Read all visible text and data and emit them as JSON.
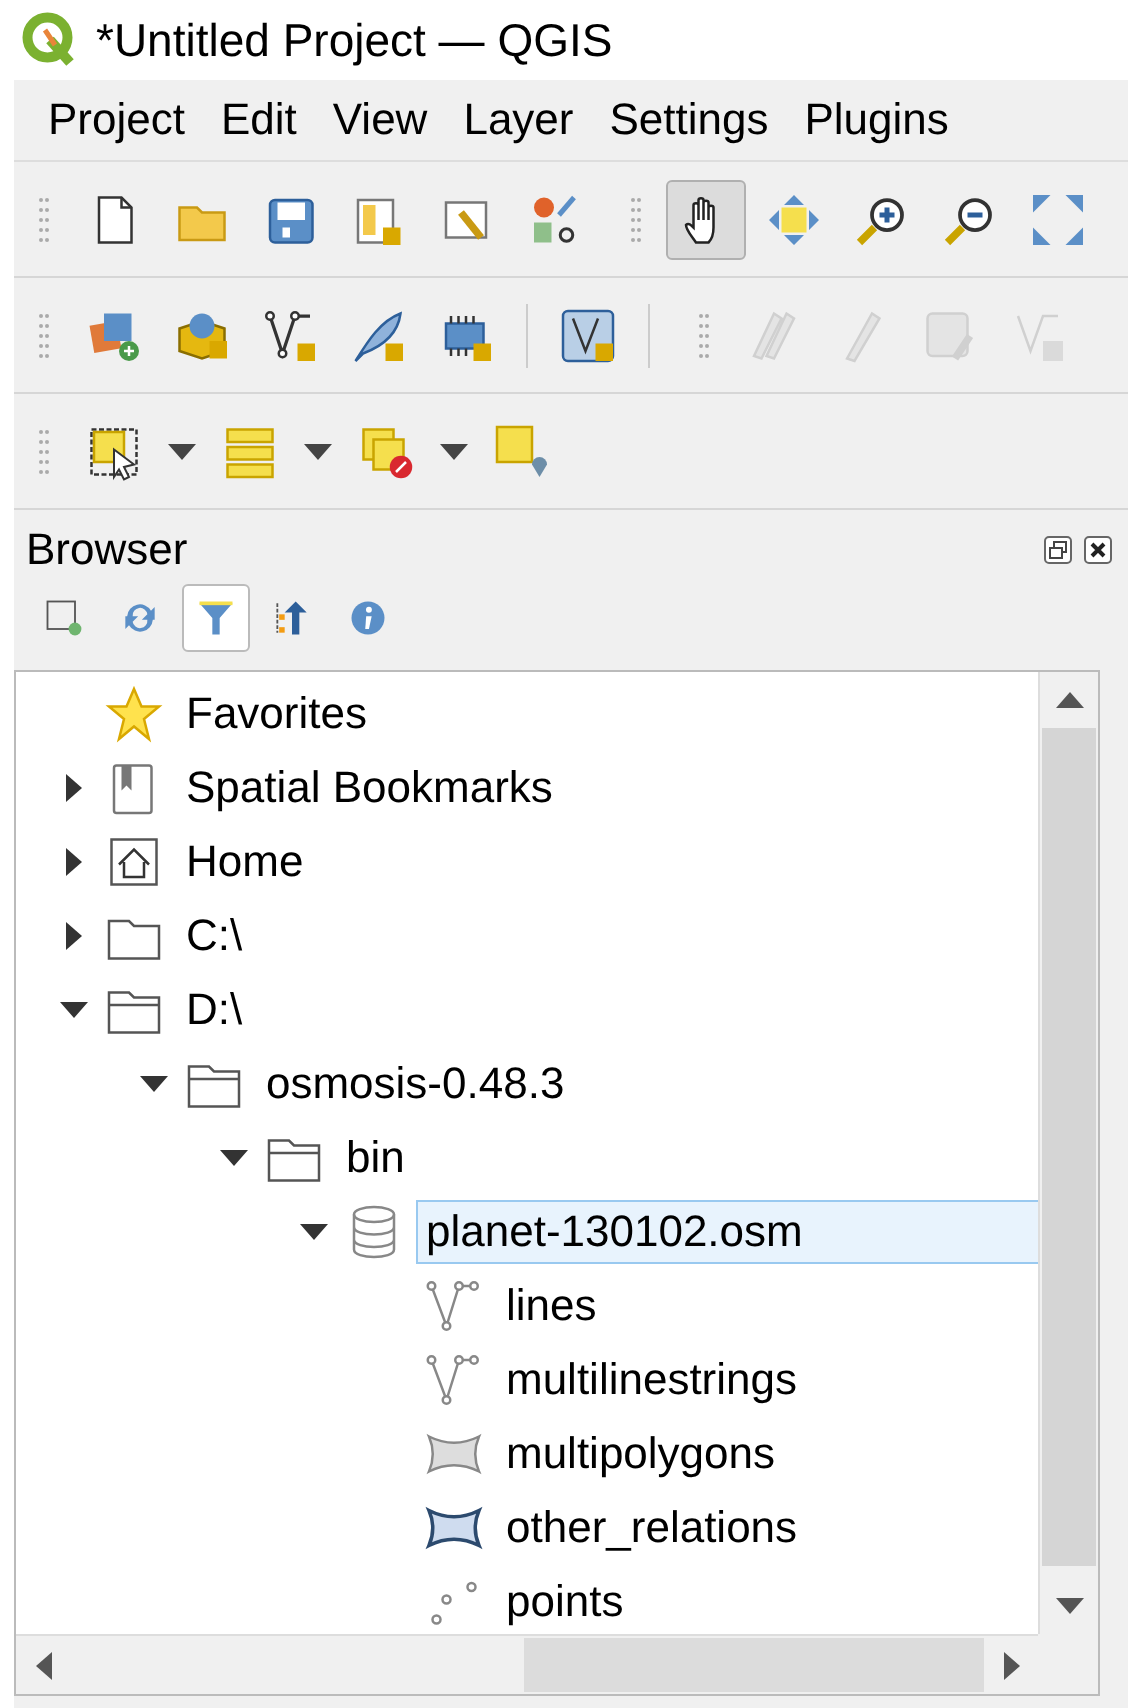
{
  "window": {
    "title": "*Untitled Project — QGIS"
  },
  "menu": [
    {
      "label": "Project"
    },
    {
      "label": "Edit"
    },
    {
      "label": "View"
    },
    {
      "label": "Layer"
    },
    {
      "label": "Settings"
    },
    {
      "label": "Plugins"
    }
  ],
  "toolbars": [
    {
      "buttons": [
        {
          "kind": "new",
          "pressed": false,
          "disabled": false
        },
        {
          "kind": "open",
          "pressed": false,
          "disabled": false
        },
        {
          "kind": "save",
          "pressed": false,
          "disabled": false
        },
        {
          "kind": "layout",
          "pressed": false,
          "disabled": false
        },
        {
          "kind": "manager",
          "pressed": false,
          "disabled": false
        },
        {
          "kind": "style",
          "pressed": false,
          "disabled": false
        },
        {
          "kind": "separator"
        },
        {
          "kind": "pan",
          "pressed": true,
          "disabled": false
        },
        {
          "kind": "pan-selection",
          "pressed": false,
          "disabled": false
        },
        {
          "kind": "zoom-in",
          "pressed": false,
          "disabled": false
        },
        {
          "kind": "zoom-out",
          "pressed": false,
          "disabled": false
        },
        {
          "kind": "zoom-full",
          "pressed": false,
          "disabled": false
        }
      ]
    },
    {
      "buttons": [
        {
          "kind": "add-layers",
          "pressed": false,
          "disabled": false
        },
        {
          "kind": "globe-box",
          "pressed": false,
          "disabled": false
        },
        {
          "kind": "vertex-line",
          "pressed": false,
          "disabled": false
        },
        {
          "kind": "feather",
          "pressed": false,
          "disabled": false
        },
        {
          "kind": "chip",
          "pressed": false,
          "disabled": false
        },
        {
          "kind": "divider"
        },
        {
          "kind": "vertex-frame",
          "pressed": false,
          "disabled": false
        },
        {
          "kind": "divider"
        },
        {
          "kind": "separator"
        },
        {
          "kind": "pencils",
          "pressed": false,
          "disabled": true
        },
        {
          "kind": "pencil",
          "pressed": false,
          "disabled": true
        },
        {
          "kind": "save-edit",
          "pressed": false,
          "disabled": true
        },
        {
          "kind": "vertex-gear",
          "pressed": false,
          "disabled": true
        }
      ]
    },
    {
      "buttons": [
        {
          "kind": "select",
          "pressed": false,
          "disabled": false
        },
        {
          "kind": "caret"
        },
        {
          "kind": "rows",
          "pressed": false,
          "disabled": false
        },
        {
          "kind": "caret"
        },
        {
          "kind": "deselect",
          "pressed": false,
          "disabled": false
        },
        {
          "kind": "caret"
        },
        {
          "kind": "pin-square",
          "pressed": false,
          "disabled": false
        }
      ]
    }
  ],
  "browser": {
    "title": "Browser",
    "tools": [
      {
        "kind": "add-square",
        "pressed": false
      },
      {
        "kind": "refresh",
        "pressed": false
      },
      {
        "kind": "filter",
        "pressed": true
      },
      {
        "kind": "collapse",
        "pressed": false
      },
      {
        "kind": "info",
        "pressed": false
      }
    ],
    "tree": [
      {
        "label": "Favorites",
        "kind": "star",
        "selected": false
      },
      {
        "label": "Spatial Bookmarks",
        "kind": "bookmark",
        "expanded": false,
        "selected": false
      },
      {
        "label": "Home",
        "kind": "home",
        "expanded": false,
        "selected": false
      },
      {
        "label": "C:\\",
        "kind": "folder",
        "expanded": false,
        "selected": false
      },
      {
        "label": "D:\\",
        "kind": "folder-open",
        "expanded": true,
        "selected": false,
        "children": [
          {
            "label": "osmosis-0.48.3",
            "kind": "folder-open",
            "expanded": true,
            "selected": false,
            "children": [
              {
                "label": "bin",
                "kind": "folder-open",
                "expanded": true,
                "selected": false,
                "children": [
                  {
                    "label": "planet-130102.osm",
                    "kind": "database",
                    "expanded": true,
                    "selected": true,
                    "children": [
                      {
                        "label": "lines",
                        "kind": "line",
                        "selected": false
                      },
                      {
                        "label": "multilinestrings",
                        "kind": "line",
                        "selected": false
                      },
                      {
                        "label": "multipolygons",
                        "kind": "polygon",
                        "selected": false
                      },
                      {
                        "label": "other_relations",
                        "kind": "polygon-blue",
                        "selected": false
                      },
                      {
                        "label": "points",
                        "kind": "points",
                        "selected": false
                      }
                    ]
                  }
                ]
              }
            ]
          }
        ]
      }
    ]
  }
}
